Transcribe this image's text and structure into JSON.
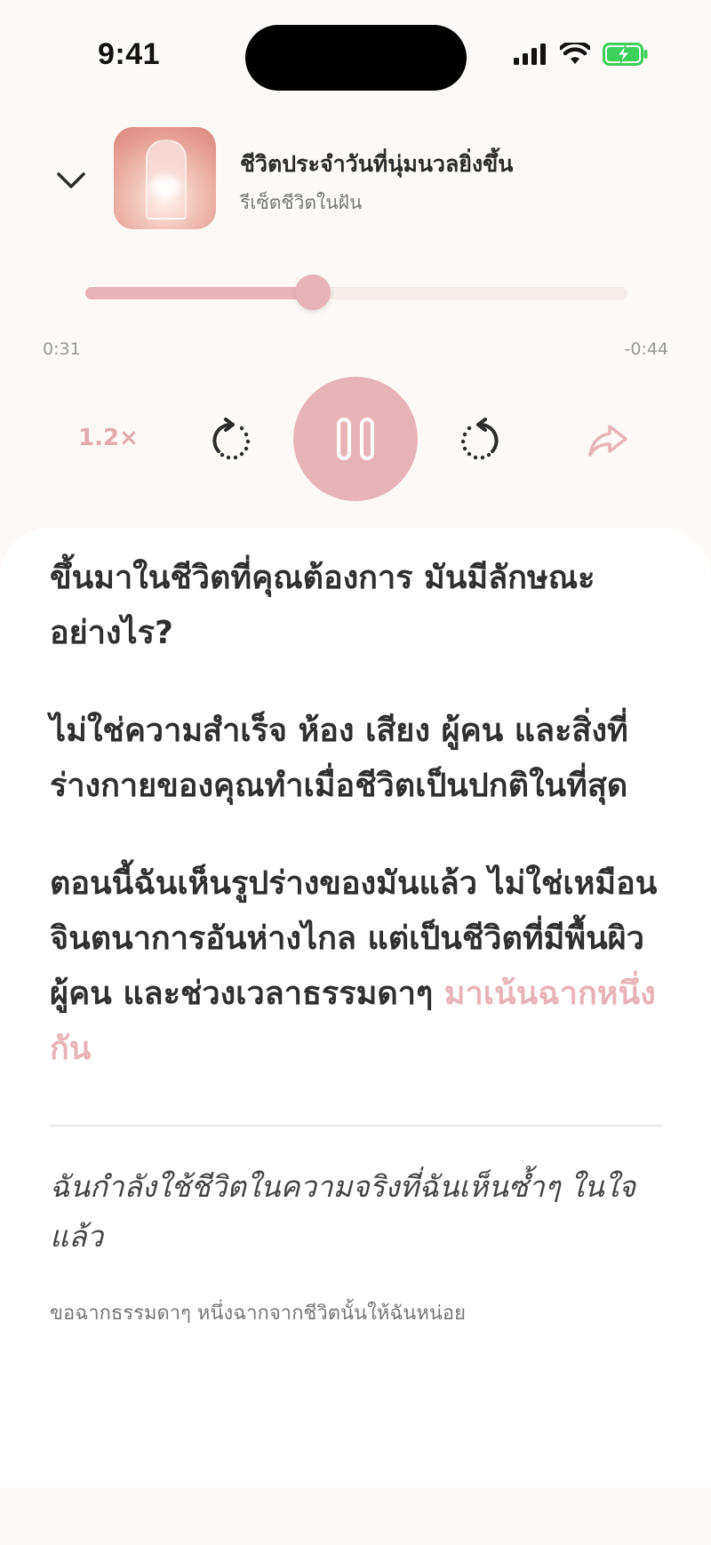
{
  "status_bar": {
    "time": "9:41"
  },
  "player": {
    "track_title": "ชีวิตประจำวันที่นุ่มนวลยิ่งขึ้น",
    "track_subtitle": "รีเซ็ตชีวิตในฝัน",
    "artwork_icon": "artwork-image",
    "progress": 0.42,
    "elapsed": "0:31",
    "remaining": "-0:44",
    "speed_label": "1.2×",
    "accent_color": "#e8b3b8"
  },
  "content": {
    "paragraphs": [
      "ขึ้นมาในชีวิตที่คุณต้องการ มันมีลักษณะอย่างไร?",
      "ไม่ใช่ความสำเร็จ ห้อง เสียง ผู้คน และสิ่งที่ร่างกายของคุณทำเมื่อชีวิตเป็นปกติในที่สุด"
    ],
    "paragraph3_main": "ตอนนี้ฉันเห็นรูปร่างของมันแล้ว ไม่ใช่เหมือนจินตนาการอันห่างไกล แต่เป็นชีวิตที่มีพื้นผิว ผู้คน และช่วงเวลาธรรมดาๆ ",
    "paragraph3_highlight": "มาเน้นฉากหนึ่งกัน",
    "quote": "ฉันกำลังใช้ชีวิตในความจริงที่ฉันเห็นซ้ำๆ ในใจแล้ว",
    "caption": "ขอฉากธรรมดาๆ หนึ่งฉากจากชีวิตนั้นให้ฉันหน่อย"
  }
}
